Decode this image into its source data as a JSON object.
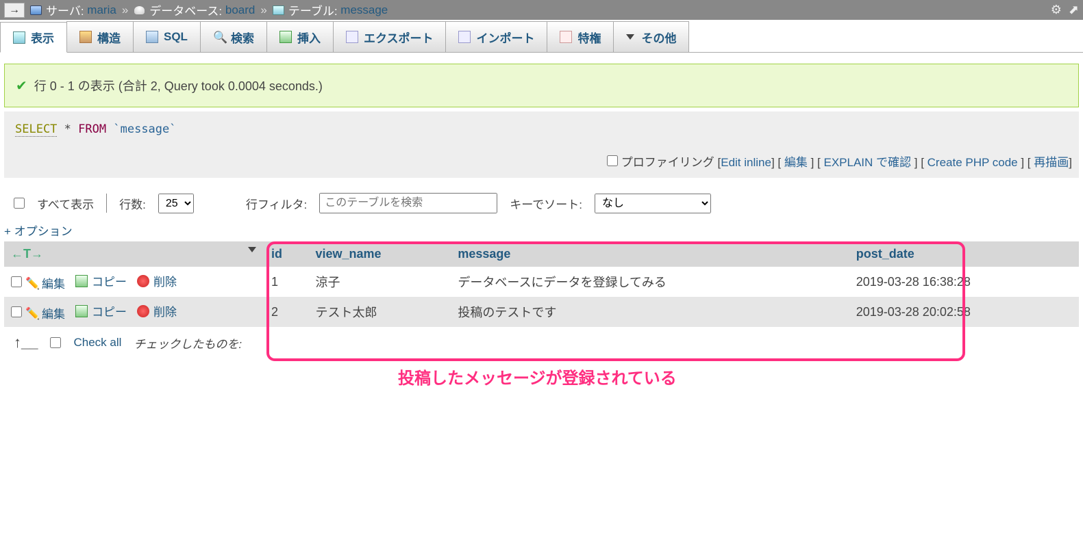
{
  "breadcrumb": {
    "server_label": "サーバ:",
    "server_name": "maria",
    "db_label": "データベース:",
    "db_name": "board",
    "table_label": "テーブル:",
    "table_name": "message"
  },
  "tabs": [
    {
      "label": "表示"
    },
    {
      "label": "構造"
    },
    {
      "label": "SQL"
    },
    {
      "label": "検索"
    },
    {
      "label": "挿入"
    },
    {
      "label": "エクスポート"
    },
    {
      "label": "インポート"
    },
    {
      "label": "特権"
    },
    {
      "label": "その他"
    }
  ],
  "success_message": "行 0 - 1 の表示 (合計 2, Query took 0.0004 seconds.)",
  "sql": {
    "select": "SELECT",
    "star": "*",
    "from": "FROM",
    "ident": "`message`"
  },
  "sql_actions": {
    "profiling": "プロファイリング",
    "edit_inline": "Edit inline",
    "edit": "編集",
    "explain": "EXPLAIN で確認",
    "create_php": "Create PHP code",
    "redraw": "再描画"
  },
  "row_controls": {
    "show_all": "すべて表示",
    "rows_label": "行数:",
    "rows_value": "25",
    "filter_label": "行フィルタ:",
    "filter_placeholder": "このテーブルを検索",
    "sort_label": "キーでソート:",
    "sort_value": "なし"
  },
  "options_link": "+ オプション",
  "table": {
    "action_header": "←T→",
    "columns": [
      "id",
      "view_name",
      "message",
      "post_date"
    ],
    "edit": "編集",
    "copy": "コピー",
    "delete": "削除",
    "rows": [
      {
        "id": "1",
        "view_name": "涼子",
        "message": "データベースにデータを登録してみる",
        "post_date": "2019-03-28 16:38:28"
      },
      {
        "id": "2",
        "view_name": "テスト太郎",
        "message": "投稿のテストです",
        "post_date": "2019-03-28 20:02:58"
      }
    ]
  },
  "footer": {
    "check_all": "Check all",
    "with_selected": "チェックしたものを:"
  },
  "annotation": "投稿したメッセージが登録されている"
}
